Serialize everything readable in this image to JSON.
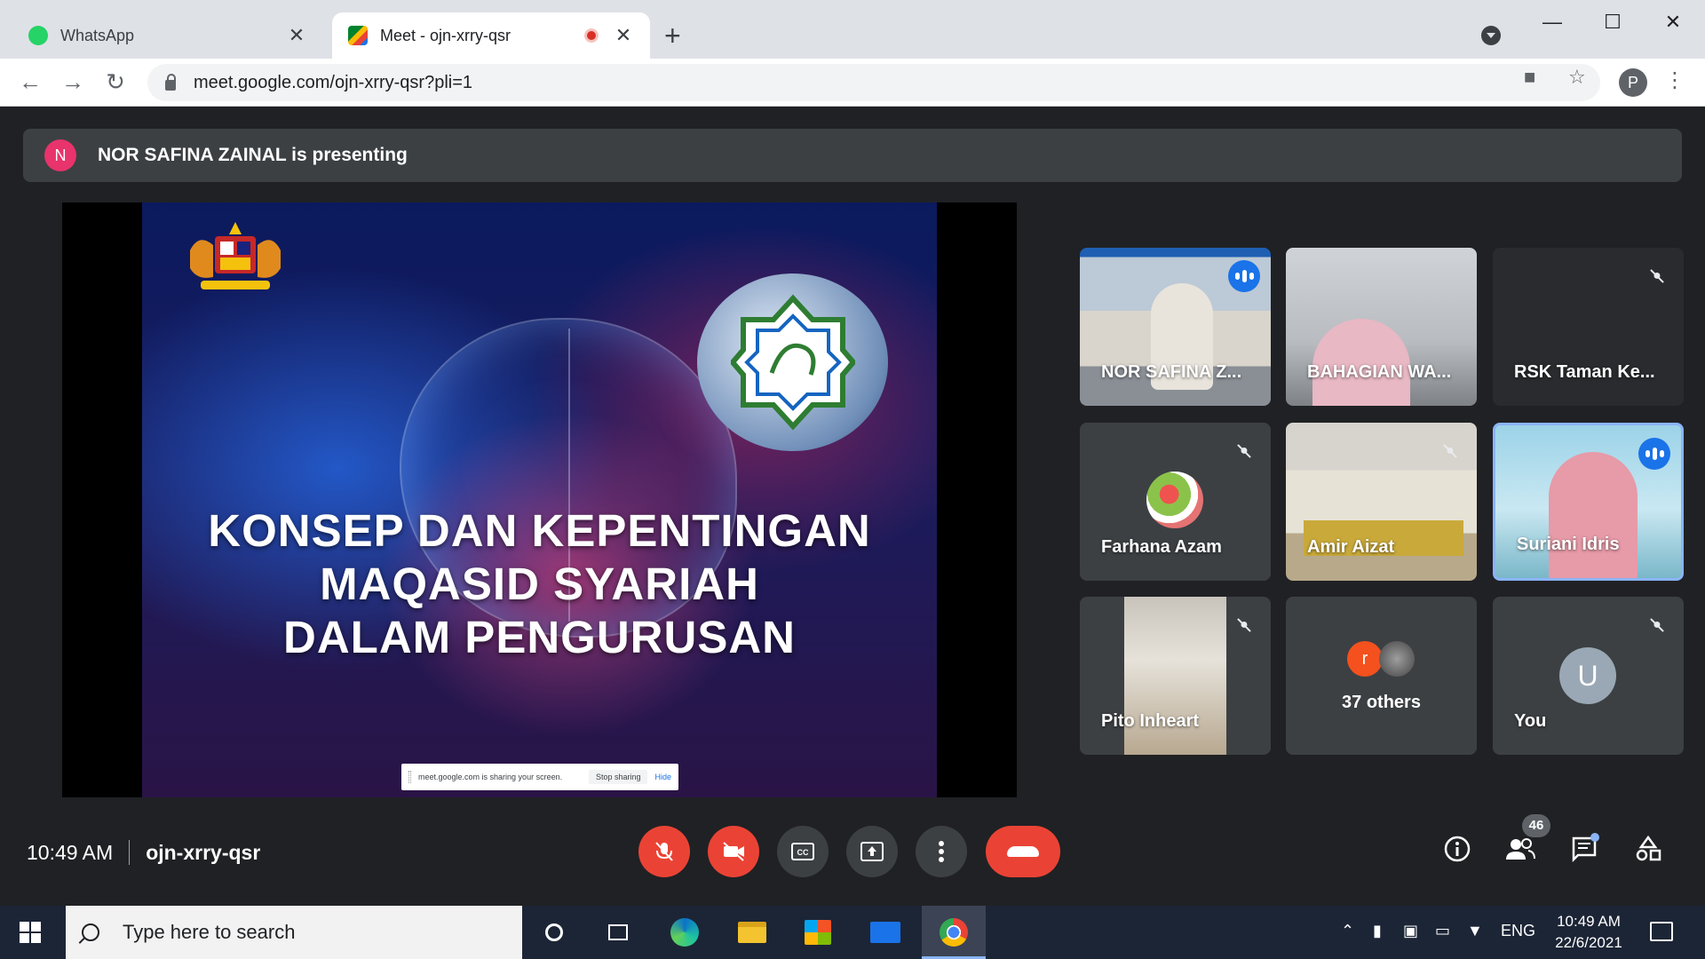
{
  "browser": {
    "tabs": [
      {
        "title": "WhatsApp",
        "close": "✕"
      },
      {
        "title": "Meet - ojn-xrry-qsr",
        "close": "✕"
      }
    ],
    "new_tab": "+",
    "url": "meet.google.com/ojn-xrry-qsr?pli=1",
    "profile_initial": "P",
    "window_controls": {
      "minimize": "—",
      "maximize": "☐",
      "close": "✕"
    }
  },
  "meet": {
    "presenter_initial": "N",
    "presenting_text": "NOR SAFINA ZAINAL is presenting",
    "slide": {
      "title_lines": [
        "KONSEP DAN KEPENTINGAN",
        "MAQASID SYARIAH",
        "DALAM PENGURUSAN"
      ],
      "share_notice": "meet.google.com is sharing your screen.",
      "stop_sharing": "Stop sharing",
      "hide": "Hide"
    },
    "participants": [
      {
        "name": "NOR SAFINA Z...",
        "speaking": true
      },
      {
        "name": "BAHAGIAN WA...",
        "speaking": false
      },
      {
        "name": "RSK Taman Ke...",
        "muted": true
      },
      {
        "name": "Farhana Azam",
        "muted": true
      },
      {
        "name": "Amir Aizat",
        "muted": true
      },
      {
        "name": "Suriani Idris",
        "speaking": true
      },
      {
        "name": "Pito Inheart",
        "muted": true
      },
      {
        "name": "37 others",
        "avatar_initial": "r"
      },
      {
        "name": "You",
        "avatar_initial": "U",
        "muted": true
      }
    ],
    "time": "10:49 AM",
    "meeting_code": "ojn-xrry-qsr",
    "people_count": "46"
  },
  "taskbar": {
    "search_placeholder": "Type here to search",
    "language": "ENG",
    "clock_time": "10:49 AM",
    "clock_date": "22/6/2021"
  },
  "colors": {
    "meet_bg": "#202124",
    "tile_bg": "#3c4043",
    "danger": "#ea4335",
    "accent": "#1a73e8"
  }
}
